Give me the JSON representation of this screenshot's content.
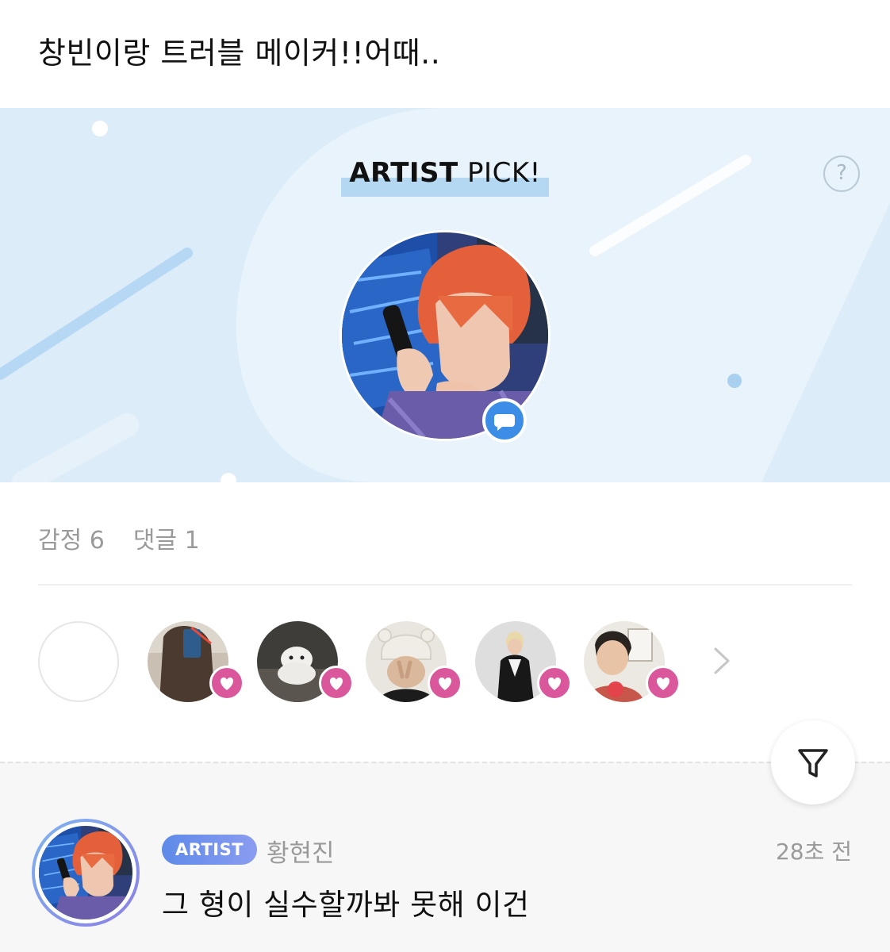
{
  "post": {
    "text": "창빈이랑 트러블 메이커!!어때.."
  },
  "artist_pick": {
    "title_bold": "ARTIST",
    "title_rest": " PICK!",
    "help_label": "?",
    "badge_icon": "chat-bubble-icon",
    "colors": {
      "banner_bg": "#dcecf8",
      "highlight": "#b5d8f2",
      "badge": "#3b8de5"
    }
  },
  "stats": {
    "emotions_label": "감정 6",
    "comments_label": "댓글 1"
  },
  "reactions": {
    "badge_icon": "heart-icon",
    "badge_color": "#d9579a",
    "more_icon": "chevron-right-icon"
  },
  "filter": {
    "icon": "filter-funnel-icon"
  },
  "comment": {
    "badge": "ARTIST",
    "author": "황현진",
    "time": "28초 전",
    "text": "그 형이 실수할까봐 못해 이건"
  }
}
